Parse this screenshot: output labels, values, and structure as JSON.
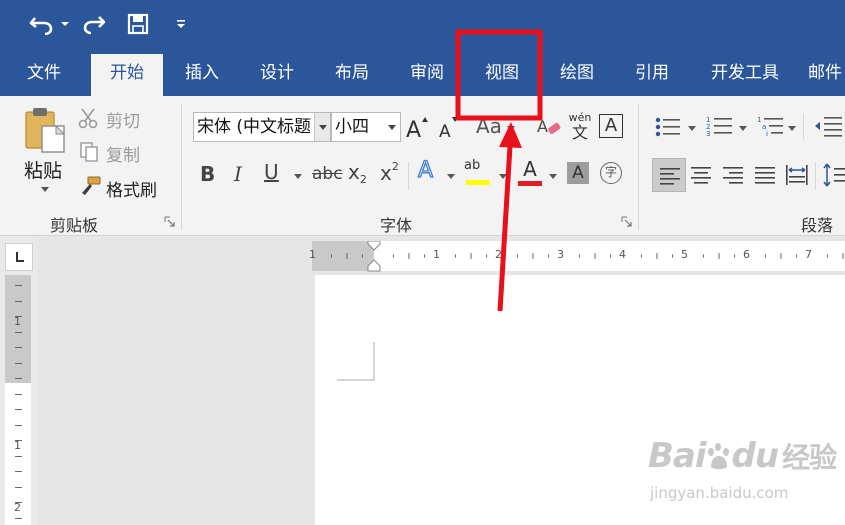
{
  "quick_access": {
    "undo_icon": "undo-icon",
    "redo_icon": "redo-icon",
    "save_icon": "save-icon",
    "customize_icon": "customize-qat-icon"
  },
  "tabs": [
    {
      "label": "文件",
      "active": false
    },
    {
      "label": "开始",
      "active": true
    },
    {
      "label": "插入",
      "active": false
    },
    {
      "label": "设计",
      "active": false
    },
    {
      "label": "布局",
      "active": false
    },
    {
      "label": "审阅",
      "active": false
    },
    {
      "label": "视图",
      "active": false,
      "highlighted": true
    },
    {
      "label": "绘图",
      "active": false
    },
    {
      "label": "引用",
      "active": false
    },
    {
      "label": "开发工具",
      "active": false
    },
    {
      "label": "邮件",
      "active": false
    }
  ],
  "clipboard": {
    "paste": "粘贴",
    "cut": "剪切",
    "copy": "复制",
    "format_painter": "格式刷",
    "group_label": "剪贴板"
  },
  "font": {
    "font_name": "宋体 (中文标题",
    "font_size": "小四",
    "grow_icon": "font-grow-icon",
    "shrink_icon": "font-shrink-icon",
    "change_case_label": "Aa",
    "phonetic_top": "wén",
    "phonetic_bottom": "文",
    "border_char": "A",
    "bold": "B",
    "italic": "I",
    "underline": "U",
    "strikethrough": "abc",
    "subscript_base": "x",
    "subscript_sub": "2",
    "superscript_base": "x",
    "superscript_sup": "2",
    "effects": "A",
    "highlight": "ab",
    "color": "A",
    "shading": "A",
    "enclose": "字",
    "group_label": "字体"
  },
  "paragraph": {
    "group_label": "段落"
  },
  "ruler": {
    "h_labels": [
      "1",
      "1",
      "2",
      "3",
      "4",
      "5",
      "6",
      "7"
    ],
    "v_labels": [
      "1",
      "1",
      "2"
    ]
  },
  "watermark": {
    "brand_a": "Bai",
    "brand_b": "du",
    "brand_c": "经验",
    "url": "jingyan.baidu.com"
  },
  "colors": {
    "ribbon_blue": "#2b579a",
    "highlight_red": "#e8101a",
    "highlight_yellow": "#ffff00",
    "font_color_red": "#e31b23"
  }
}
